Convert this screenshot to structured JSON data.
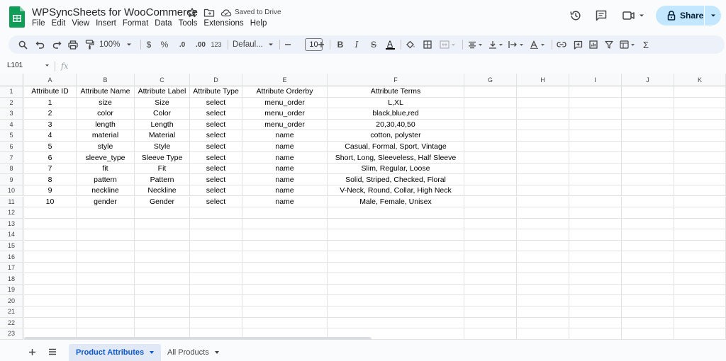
{
  "app": {
    "title": "WPSyncSheets for WooCommerce",
    "saved_status": "Saved to Drive",
    "share_label": "Share"
  },
  "menu": [
    "File",
    "Edit",
    "View",
    "Insert",
    "Format",
    "Data",
    "Tools",
    "Extensions",
    "Help"
  ],
  "toolbar": {
    "zoom": "100%",
    "currency": "$",
    "percent": "%",
    "decrease_decimals": ".0",
    "increase_decimals": ".00",
    "number_format": "123",
    "font_family": "Defaul...",
    "font_size": "10",
    "bold": "B",
    "italic": "I",
    "strikethrough": "S",
    "text_color": "A",
    "sum": "Σ"
  },
  "formula_bar": {
    "name_box": "L101",
    "fx_label": "fx"
  },
  "grid": {
    "columns": [
      "A",
      "B",
      "C",
      "D",
      "E",
      "F",
      "G",
      "H",
      "I",
      "J",
      "K"
    ],
    "row_numbers": [
      "1",
      "2",
      "3",
      "4",
      "5",
      "6",
      "7",
      "8",
      "9",
      "10",
      "11",
      "12",
      "13",
      "14",
      "15",
      "16",
      "17",
      "18",
      "19",
      "20",
      "21",
      "22",
      "23"
    ],
    "rows": [
      [
        "Attribute ID",
        "Attribute Name",
        "Attribute Label",
        "Attribute Type",
        "Attribute Orderby",
        "Attribute Terms"
      ],
      [
        "1",
        "size",
        "Size",
        "select",
        "menu_order",
        "L,XL"
      ],
      [
        "2",
        "color",
        "Color",
        "select",
        "menu_order",
        "black,blue,red"
      ],
      [
        "3",
        "length",
        "Length",
        "select",
        "menu_order",
        "20,30,40,50"
      ],
      [
        "4",
        "material",
        "Material",
        "select",
        "name",
        "cotton, polyster"
      ],
      [
        "5",
        "style",
        "Style",
        "select",
        "name",
        "Casual, Formal, Sport, Vintage"
      ],
      [
        "6",
        "sleeve_type",
        "Sleeve Type",
        "select",
        "name",
        "Short, Long, Sleeveless, Half Sleeve"
      ],
      [
        "7",
        "fit",
        "Fit",
        "select",
        "name",
        "Slim, Regular, Loose"
      ],
      [
        "8",
        "pattern",
        "Pattern",
        "select",
        "name",
        "Solid, Striped, Checked, Floral"
      ],
      [
        "9",
        "neckline",
        "Neckline",
        "select",
        "name",
        "V-Neck, Round, Collar, High Neck"
      ],
      [
        "10",
        "gender",
        "Gender",
        "select",
        "name",
        "Male, Female, Unisex"
      ]
    ]
  },
  "sheets": [
    {
      "label": "Product Attributes",
      "active": true
    },
    {
      "label": "All Products",
      "active": false
    }
  ],
  "colors": {
    "accent": "#0b57d0",
    "share_bg": "#c2e7ff",
    "sheets_green": "#0f9d58"
  }
}
